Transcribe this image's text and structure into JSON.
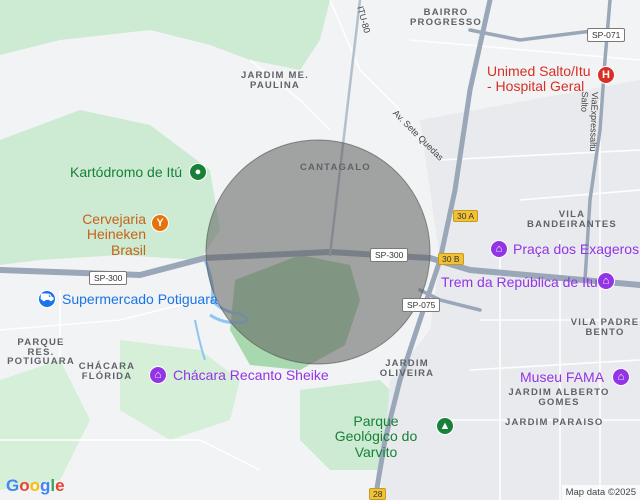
{
  "map": {
    "attribution": "Map data ©2025",
    "google_logo": [
      "G",
      "o",
      "o",
      "g",
      "l",
      "e"
    ],
    "logo_colors": [
      "#4285f4",
      "#ea4335",
      "#fbbc05",
      "#4285f4",
      "#34a853",
      "#ea4335"
    ]
  },
  "areas": {
    "bairro_progresso": "BAIRRO PROGRESSO",
    "jardim_me_paulina": "JARDIM ME. PAULINA",
    "cantagalo": "CANTAGALO",
    "vila_bandeirantes": "VILA BANDEIRANTES",
    "parque_res_potiguara": "PARQUE RES. POTIGUARA",
    "chacara_florida": "CHÁCARA FLÓRIDA",
    "jardim_oliveira": "JARDIM OLIVEIRA",
    "vila_padre_bento": "VILA PADRE BENTO",
    "jardim_alberto_gomes": "JARDIM ALBERTO GOMES",
    "jardim_paraiso": "JARDIM PARAISO"
  },
  "pois": {
    "unimed": "Unimed Salto/Itu - Hospital Geral",
    "kartodromo": "Kartódromo de Itú",
    "cervejaria": "Cervejaria Heineken Brasil",
    "supermercado": "Supermercado Potiguara",
    "praca": "Praça dos Exageros",
    "trem": "Trem da República de Itu",
    "chacara_recanto": "Chácara Recanto Sheike",
    "museu": "Museu FAMA",
    "parque_geologico": "Parque Geológico do Varvito"
  },
  "roads": {
    "itu_80": "ITU-80",
    "sp_071": "SP-071",
    "sp_300_a": "SP-300",
    "sp_300_b": "SP-300",
    "sp_075": "SP-075",
    "exit_30a": "30 A",
    "exit_30b": "30 B",
    "sp_28": "28",
    "av_sete_quedas": "Av. Sete Quedas",
    "via_expressa": "ViaExpressaltu Salto"
  }
}
